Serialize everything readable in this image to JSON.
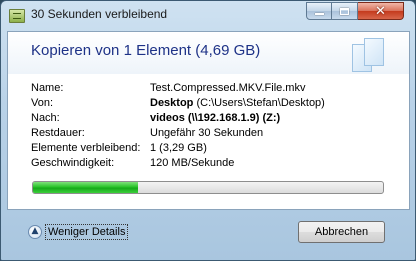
{
  "window": {
    "title": "30 Sekunden verbleibend"
  },
  "main": {
    "headline": "Kopieren von 1 Element (4,69 GB)",
    "details": [
      {
        "label": "Name:",
        "value": "Test.Compressed.MKV.File.mkv",
        "value_bold": ""
      },
      {
        "label": "Von:",
        "value_bold": "Desktop",
        "value": " (C:\\Users\\Stefan\\Desktop)"
      },
      {
        "label": "Nach:",
        "value_bold": "videos (\\\\192.168.1.9) (Z:)",
        "value": ""
      },
      {
        "label": "Restdauer:",
        "value": "Ungefähr 30 Sekunden",
        "value_bold": ""
      },
      {
        "label": "Elemente verbleibend:",
        "value": "1 (3,29 GB)",
        "value_bold": ""
      },
      {
        "label": "Geschwindigkeit:",
        "value": "120 MB/Sekunde",
        "value_bold": ""
      }
    ],
    "progress_fraction": 0.3
  },
  "footer": {
    "toggle_label": "Weniger Details",
    "cancel_label": "Abbrechen"
  },
  "colors": {
    "headline": "#1e3287",
    "progress": "#16a81a"
  },
  "icons": {
    "app": "copy-progress-icon",
    "header": "copy-pages-icon",
    "toggle": "chevron-up-circle-icon"
  }
}
